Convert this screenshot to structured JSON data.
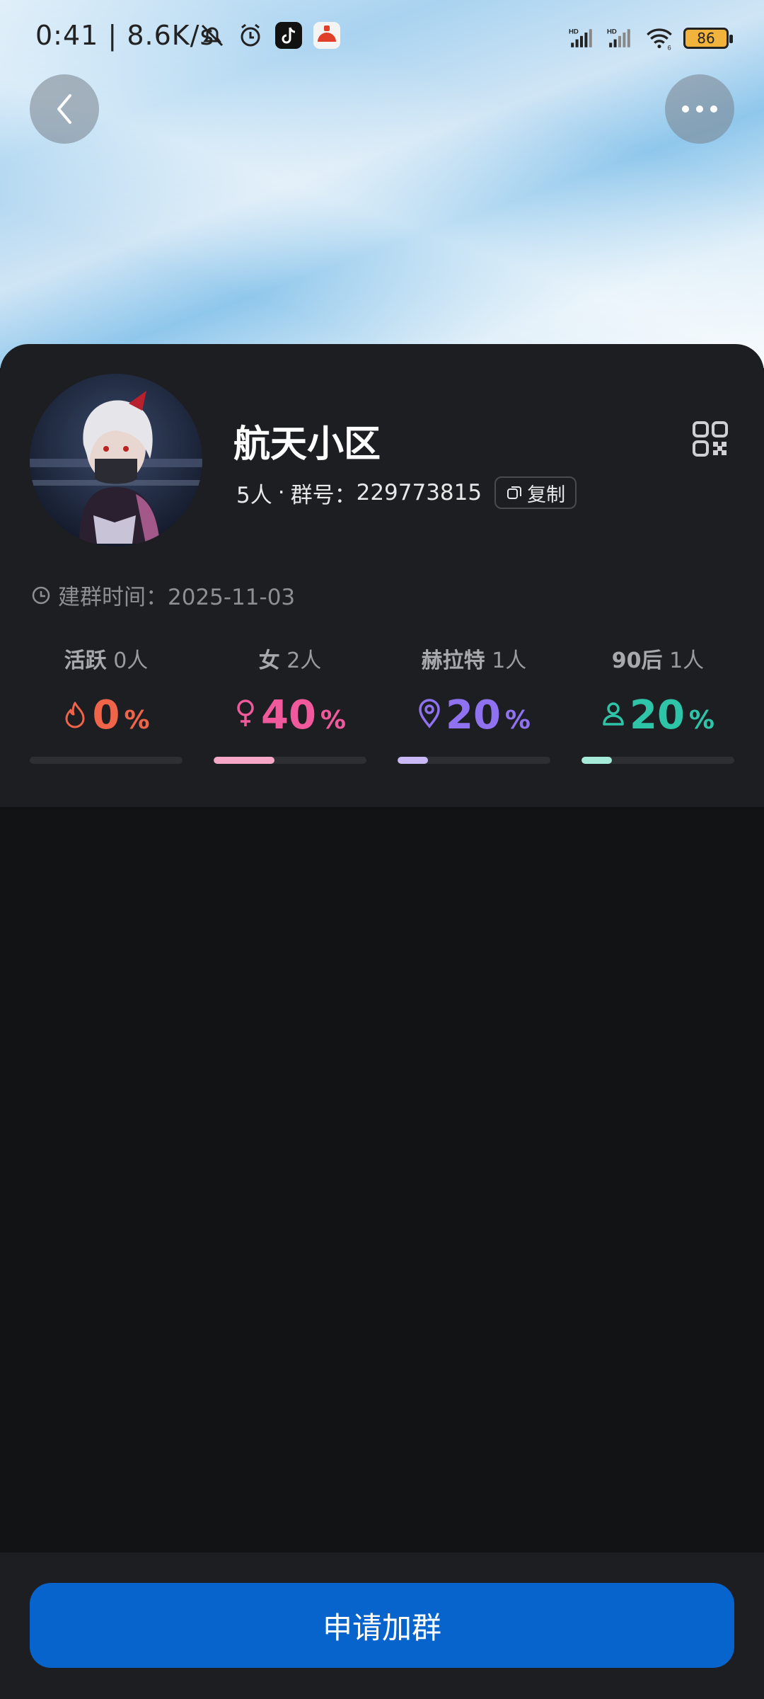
{
  "status_bar": {
    "time": "0:41",
    "speed": "8.6K/s",
    "battery": "86"
  },
  "header": {
    "back_icon": "chevron-left-icon",
    "more_icon": "more-dots-icon"
  },
  "group": {
    "name": "航天小区",
    "members": "5人",
    "dot": "·",
    "id_label": "群号：",
    "id": "229773815",
    "copy_label": "复制",
    "created_label": "建群时间：",
    "created_date": "2025-11-03"
  },
  "stats": [
    {
      "title": "活跃",
      "count": "0人",
      "value": "0",
      "unit": "%",
      "percent": 0,
      "color": "#f0644a",
      "icon": "fire-icon",
      "bar_color": "#f0644a"
    },
    {
      "title": "女",
      "count": "2人",
      "value": "40",
      "unit": "%",
      "percent": 40,
      "color": "#f05a9c",
      "icon": "female-icon",
      "bar_color": "#f6a6c6"
    },
    {
      "title": "赫拉特",
      "count": "1人",
      "value": "20",
      "unit": "%",
      "percent": 20,
      "color": "#8f72f0",
      "icon": "location-pin-icon",
      "bar_color": "#c9b9f7"
    },
    {
      "title": "90后",
      "count": "1人",
      "value": "20",
      "unit": "%",
      "percent": 20,
      "color": "#2ec4a8",
      "icon": "person-icon",
      "bar_color": "#a6ead9"
    }
  ],
  "footer": {
    "join_label": "申请加群"
  },
  "colors": {
    "primary_button": "#0764cc",
    "card_bg": "#1d1e21",
    "page_bg": "#121315"
  }
}
